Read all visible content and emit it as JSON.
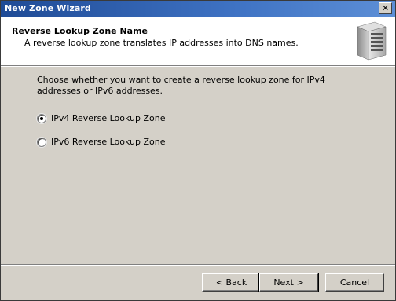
{
  "window": {
    "title": "New Zone Wizard",
    "close_symbol": "✕"
  },
  "header": {
    "title": "Reverse Lookup Zone Name",
    "description": "A reverse lookup zone translates IP addresses into DNS names.",
    "icon": "server-icon"
  },
  "body": {
    "prompt": "Choose whether you want to create a reverse lookup zone for IPv4 addresses or IPv6 addresses.",
    "options": [
      {
        "label": "IPv4 Reverse Lookup Zone",
        "selected": true
      },
      {
        "label": "IPv6 Reverse Lookup Zone",
        "selected": false
      }
    ]
  },
  "buttons": {
    "back": "< Back",
    "next": "Next >",
    "cancel": "Cancel"
  },
  "colors": {
    "titlebar_start": "#1f4b96",
    "titlebar_end": "#5d8fd6",
    "face": "#d4d0c8"
  }
}
